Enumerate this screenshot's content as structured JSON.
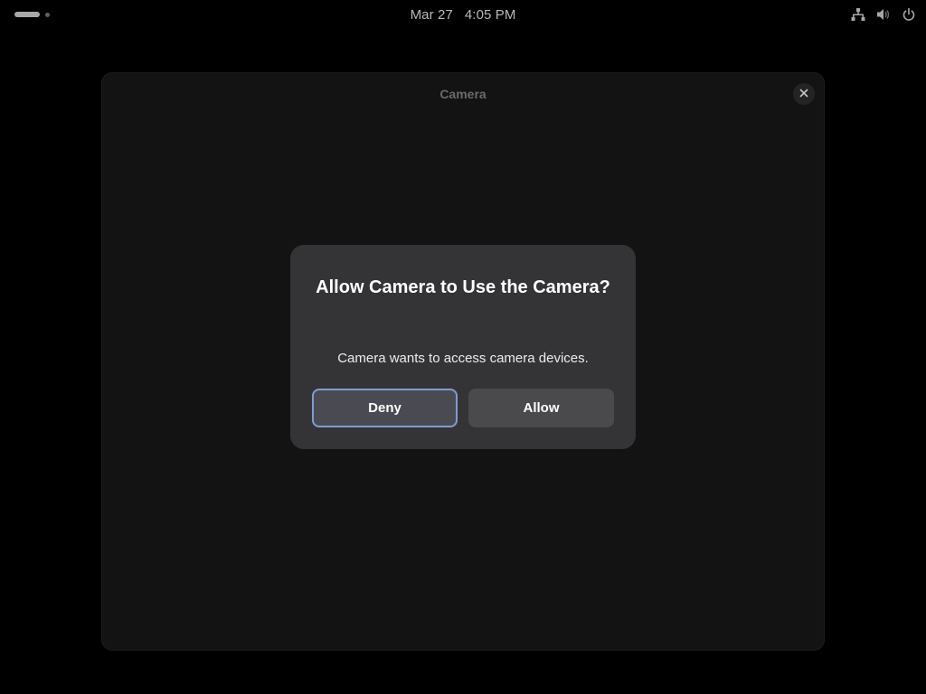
{
  "topbar": {
    "date": "Mar 27",
    "time": "4:05 PM",
    "tray_icons": [
      "network-icon",
      "volume-icon",
      "power-icon"
    ]
  },
  "window": {
    "title": "Camera",
    "close_icon": "close-icon"
  },
  "dialog": {
    "title": "Allow Camera to Use the Camera?",
    "body": "Camera wants to access camera devices.",
    "deny_label": "Deny",
    "allow_label": "Allow"
  },
  "colors": {
    "desktop_bg": "#000000",
    "window_bg": "#131313",
    "dialog_bg": "#343437",
    "focus_ring": "#7f9ccf",
    "button_bg": "#4a4a4d"
  }
}
